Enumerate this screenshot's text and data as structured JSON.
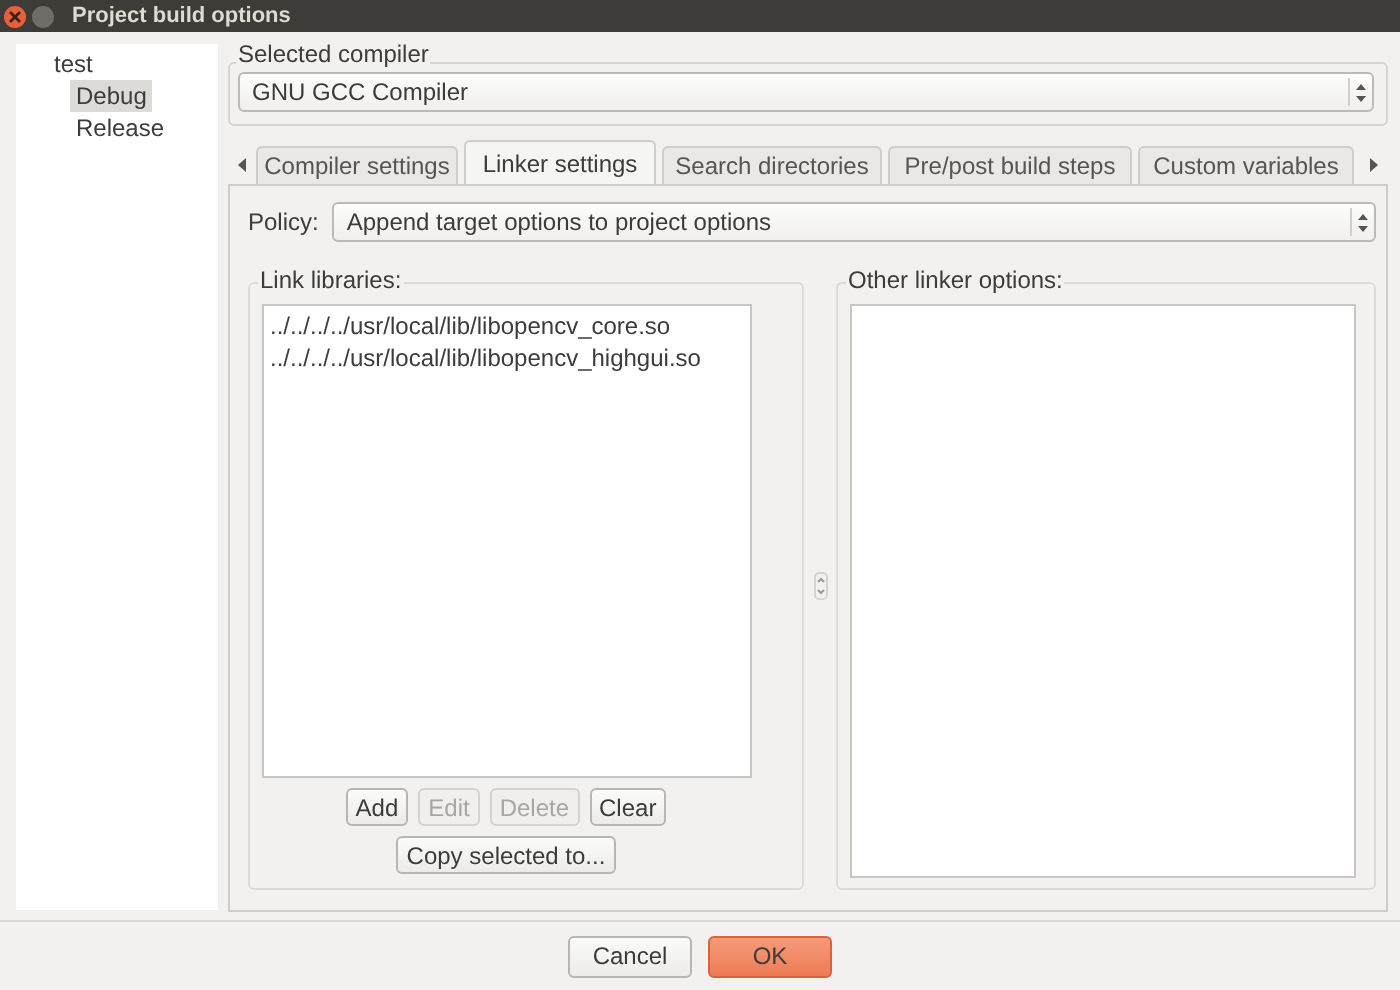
{
  "window": {
    "title": "Project build options"
  },
  "tree": {
    "label": "test",
    "children": [
      {
        "label": "Debug",
        "selected": true
      },
      {
        "label": "Release",
        "selected": false
      }
    ]
  },
  "selected_compiler": {
    "label": "Selected compiler",
    "value": "GNU GCC Compiler"
  },
  "tabs": [
    {
      "label": "Compiler settings",
      "selected": false
    },
    {
      "label": "Linker settings",
      "selected": true
    },
    {
      "label": "Search directories",
      "selected": false
    },
    {
      "label": "Pre/post build steps",
      "selected": false
    },
    {
      "label": "Custom variables",
      "selected": false
    }
  ],
  "policy": {
    "label": "Policy:",
    "value": "Append target options to project options"
  },
  "link_libraries": {
    "label": "Link libraries:",
    "items": [
      "../../../../usr/local/lib/libopencv_core.so",
      "../../../../usr/local/lib/libopencv_highgui.so"
    ],
    "buttons": [
      {
        "label": "Add",
        "disabled": false
      },
      {
        "label": "Edit",
        "disabled": true
      },
      {
        "label": "Delete",
        "disabled": true
      },
      {
        "label": "Clear",
        "disabled": false
      }
    ],
    "copy_button": "Copy selected to..."
  },
  "other_linker_options": {
    "label": "Other linker options:"
  },
  "buttons": [
    {
      "label": "Cancel",
      "kind": "normal"
    },
    {
      "label": "OK",
      "kind": "default"
    }
  ]
}
